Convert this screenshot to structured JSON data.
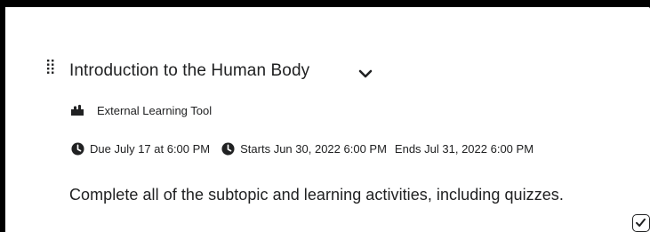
{
  "activity": {
    "title": "Introduction to the Human Body",
    "type_label": "External Learning Tool",
    "due": "Due July 17 at 6:00 PM",
    "starts": "Starts Jun 30, 2022 6:00 PM",
    "ends": "Ends Jul 31, 2022 6:00 PM",
    "description": "Complete all of the subtopic and learning activities, including quizzes.",
    "completed": true
  },
  "icons": {
    "drag": "drag-handle-icon",
    "expand": "chevron-down-icon",
    "tool": "puzzle-piece-icon",
    "due": "clock-icon",
    "starts": "clock-icon",
    "completion": "checkmark-icon"
  },
  "colors": {
    "text": "#202122",
    "frame_border": "#000000",
    "background": "#ffffff"
  }
}
